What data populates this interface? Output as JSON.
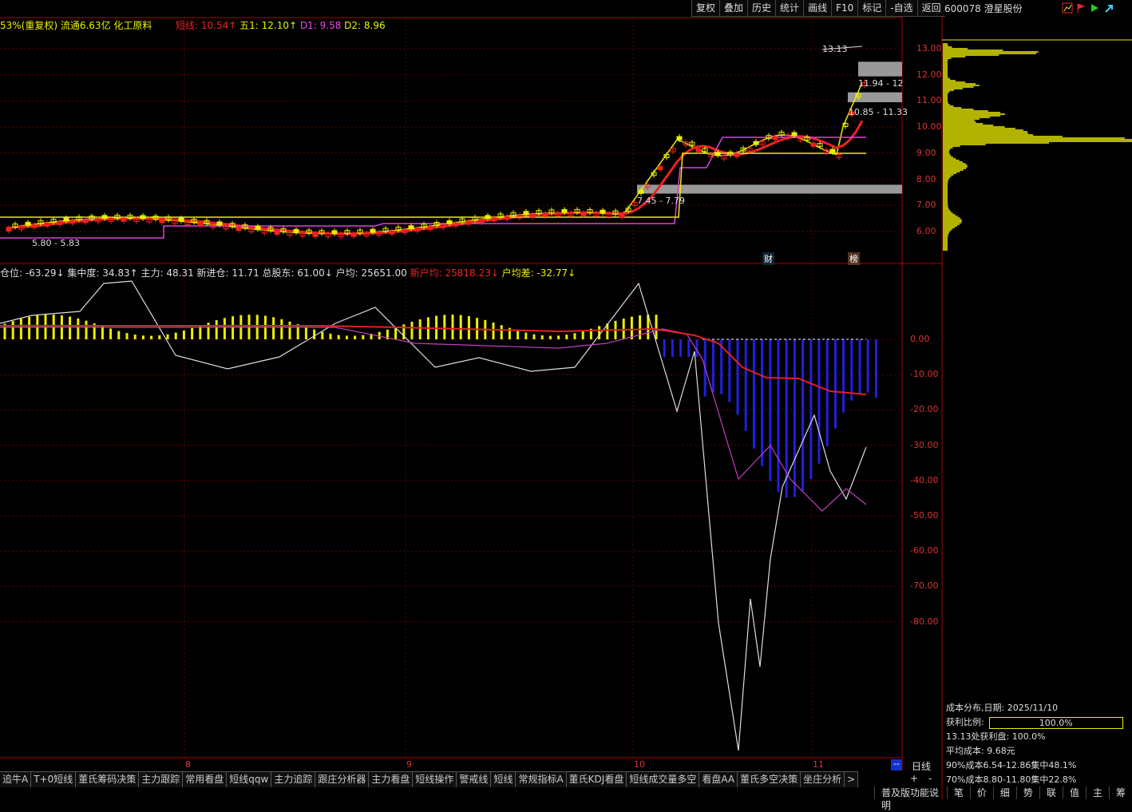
{
  "toolbar": [
    "复权",
    "叠加",
    "历史",
    "统计",
    "画线",
    "F10",
    "标记",
    "-自选",
    "返回"
  ],
  "stock": {
    "code": "600078",
    "name": "澄星股份"
  },
  "legend_main": {
    "prefix": "53%(重复权) 流通6.63亿 化工原料",
    "short_label": "短线: 10.54↑",
    "wu_label": "五1: 12.10↑",
    "d1_label": "D1: 9.58",
    "d2_label": "D2: 8.96"
  },
  "legend_sub": {
    "prefix": "仓位: -63.29↓ 集中度: 34.83↑ 主力: 48.31 新进仓: 11.71 总股东: 61.00↓",
    "hujun": "户均: 25651.00",
    "new_hujun": "新户均: 25818.23↓",
    "diff": "户均差: -32.77↓"
  },
  "price_axis": [
    "13.00",
    "12.00",
    "11.00",
    "10.00",
    "9.00",
    "8.00",
    "7.00",
    "6.00"
  ],
  "sub_axis": [
    "0.00",
    "-10.00",
    "-20.00",
    "-30.00",
    "-40.00",
    "-50.00",
    "-60.00",
    "-70.00",
    "-80.00"
  ],
  "chart_annotations": {
    "high": "13.13",
    "band1": "11.94 - 12",
    "band2": "10.85 - 11.33",
    "band3": "7.45 - 7.79",
    "low": "5.80 - 5.83",
    "cai": "财",
    "bang": "榜"
  },
  "months": [
    "8",
    "9",
    "10",
    "11"
  ],
  "period": "日线",
  "tabs": [
    "追牛A",
    "T+0短线",
    "董氏筹码决策",
    "主力跟踪",
    "常用看盘",
    "短线qqw",
    "主力追踪",
    "跟庄分析器",
    "主力看盘",
    "短线操作",
    "警戒线",
    "短线",
    "常规指标A",
    "董氏KDJ看盘",
    "短线成交量多空",
    "看盘AA",
    "董氏多空决策",
    "坐庄分析"
  ],
  "tab_more": ">",
  "zoom": {
    "plus": "+",
    "minus": "-"
  },
  "cost_info": {
    "date_label": "成本分布,日期: 2025/11/10",
    "ratio_label": "获利比例:",
    "ratio_value": "100.0%",
    "profit_line": "13.13处获利盘: 100.0%",
    "avg_line": "平均成本: 9.68元",
    "c90": "90%成本6.54-12.86集中48.1%",
    "c70": "70%成本8.80-11.80集中22.8%"
  },
  "bottom": [
    "普及版功能说明",
    "笔",
    "价",
    "细",
    "势",
    "联",
    "值",
    "主",
    "筹"
  ],
  "colors": {
    "red": "#e02020",
    "yellow": "#f0f000",
    "magenta": "#e040e0",
    "blue": "#2020e0",
    "cyan": "#40e0f0"
  }
}
